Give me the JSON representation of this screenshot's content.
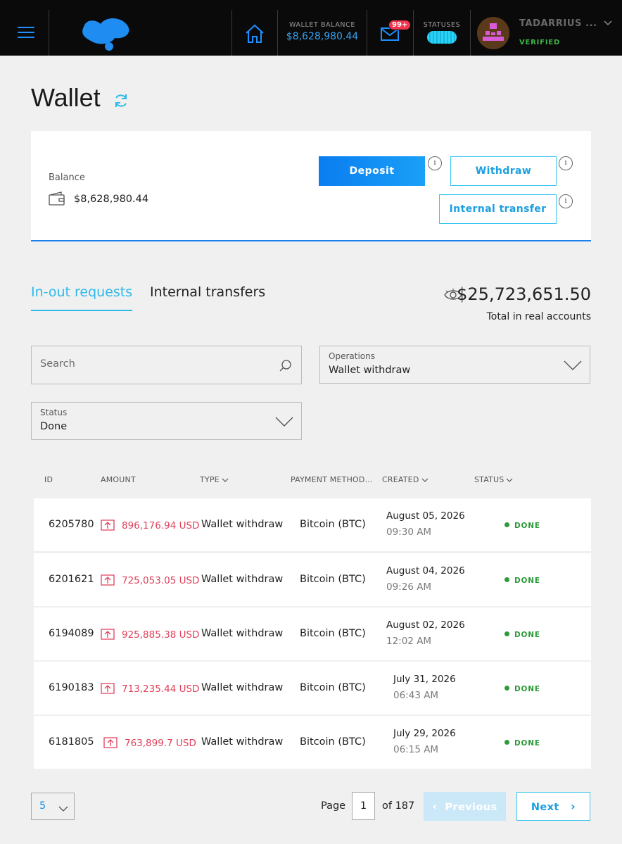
{
  "header": {
    "wallet_balance_label": "WALLET BALANCE",
    "wallet_balance_value": "$8,628,980.44",
    "mail_badge": "99+",
    "statuses_label": "STATUSES",
    "user_name": "TADARRIUS ...",
    "user_status": "VERIFIED"
  },
  "page": {
    "title": "Wallet"
  },
  "balance_card": {
    "label": "Balance",
    "value": "$8,628,980.44",
    "deposit_label": "Deposit",
    "withdraw_label": "Withdraw",
    "internal_transfer_label": "Internal transfer",
    "info_glyph": "i"
  },
  "tabs": [
    {
      "label": "In-out requests",
      "active": true
    },
    {
      "label": "Internal transfers",
      "active": false
    }
  ],
  "totals": {
    "value": "$25,723,651.50",
    "label": "Total in real accounts"
  },
  "filters": {
    "search_placeholder": "Search",
    "operations_label": "Operations",
    "operations_value": "Wallet withdraw",
    "status_label": "Status",
    "status_value": "Done"
  },
  "table": {
    "columns": [
      "ID",
      "AMOUNT",
      "TYPE",
      "PAYMENT METHOD...",
      "CREATED",
      "STATUS"
    ],
    "rows": [
      {
        "id": "6205780",
        "amount": "896,176.94 USD",
        "type": "Wallet withdraw",
        "payment": "Bitcoin (BTC)",
        "date": "August 05, 2026",
        "time": "09:30 AM",
        "status": "DONE"
      },
      {
        "id": "6201621",
        "amount": "725,053.05 USD",
        "type": "Wallet withdraw",
        "payment": "Bitcoin (BTC)",
        "date": "August 04, 2026",
        "time": "09:26 AM",
        "status": "DONE"
      },
      {
        "id": "6194089",
        "amount": "925,885.38 USD",
        "type": "Wallet withdraw",
        "payment": "Bitcoin (BTC)",
        "date": "August 02, 2026",
        "time": "12:02 AM",
        "status": "DONE"
      },
      {
        "id": "6190183",
        "amount": "713,235.44 USD",
        "type": "Wallet withdraw",
        "payment": "Bitcoin (BTC)",
        "date": "July 31, 2026",
        "time": "06:43 AM",
        "status": "DONE"
      },
      {
        "id": "6181805",
        "amount": "763,899.7 USD",
        "type": "Wallet withdraw",
        "payment": "Bitcoin (BTC)",
        "date": "July 29, 2026",
        "time": "06:15 AM",
        "status": "DONE"
      }
    ]
  },
  "pagination": {
    "per_page": "5",
    "page_label": "Page",
    "current_page": "1",
    "of_label": "of 187",
    "previous_label": "Previous",
    "next_label": "Next"
  },
  "colors": {
    "accent": "#2fb8ea",
    "deposit": "#0a7df0",
    "amount_negative": "#e0405a",
    "status_done": "#2e9a3a",
    "verified": "#3bb54a"
  }
}
